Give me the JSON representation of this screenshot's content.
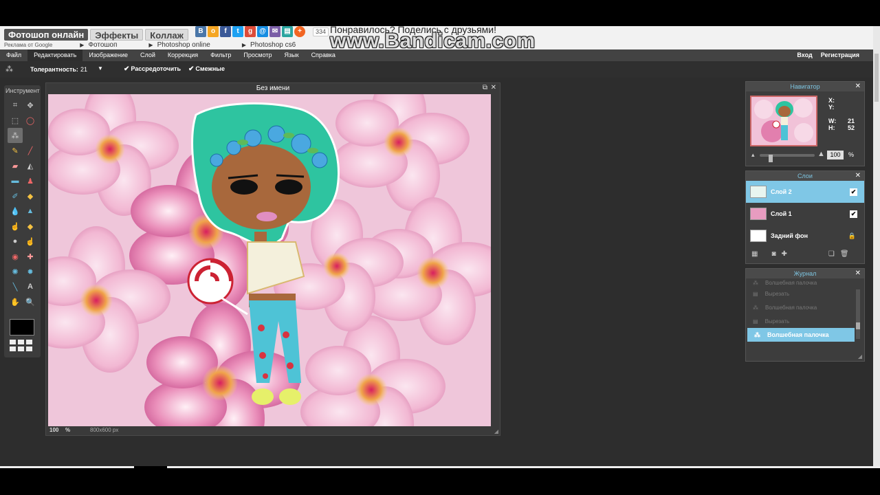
{
  "site": {
    "tabs": [
      "Фотошоп онлайн",
      "Эффекты",
      "Коллаж"
    ],
    "share_count": "334",
    "share_text": "Понравилось? Поделись с друзьями!",
    "ad_label": "Реклама от Google",
    "ad_links": [
      "Фотошоп",
      "Photoshop online",
      "Photoshop cs6"
    ],
    "watermark": "www.Bandicam.com"
  },
  "menu": {
    "items": [
      "Файл",
      "Редактировать",
      "Изображение",
      "Слой",
      "Коррекция",
      "Фильтр",
      "Просмотр",
      "Язык",
      "Справка"
    ],
    "login": "Вход",
    "register": "Регистрация"
  },
  "options": {
    "tolerance_label": "Толерантность:",
    "tolerance_value": "21",
    "antialias_label": "Рассредоточить",
    "contiguous_label": "Смежные"
  },
  "toolbox": {
    "title": "Инструмент",
    "foreground_color": "#000000"
  },
  "document": {
    "title": "Без имени",
    "zoom": "100",
    "zoom_unit": "%",
    "size": "800x600 px"
  },
  "navigator": {
    "title": "Навигатор",
    "x_label": "X:",
    "y_label": "Y:",
    "w_label": "W:",
    "w_value": "21",
    "h_label": "H:",
    "h_value": "52",
    "zoom": "100",
    "zoom_unit": "%",
    "zoom_level": 0.18
  },
  "layers": {
    "title": "Слои",
    "items": [
      {
        "name": "Слой 2",
        "visible": true,
        "selected": true
      },
      {
        "name": "Слой 1",
        "visible": true,
        "selected": false
      },
      {
        "name": "Задний фон",
        "locked": true,
        "selected": false
      }
    ]
  },
  "history": {
    "title": "Журнал",
    "items": [
      "Волшебная палочка",
      "Вырезать",
      "Волшебная палочка",
      "Вырезать",
      "Волшебная палочка"
    ],
    "active_index": 4
  },
  "colors": {
    "accent": "#7fc7e6",
    "menubar": "#434343",
    "workspace": "#2d2d2d"
  }
}
